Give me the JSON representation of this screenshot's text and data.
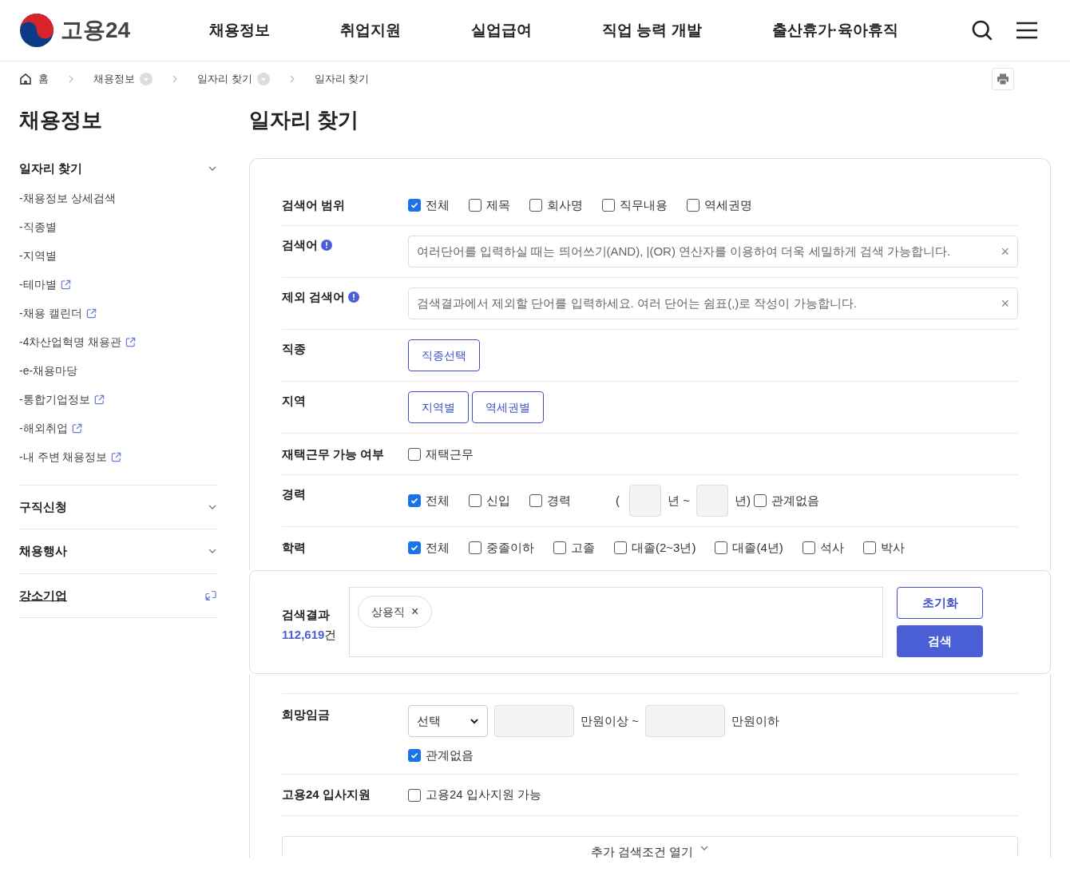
{
  "header": {
    "logo_text": "고용24",
    "nav": [
      "채용정보",
      "취업지원",
      "실업급여",
      "직업 능력 개발",
      "출산휴가·육아휴직"
    ]
  },
  "breadcrumb": [
    {
      "label": "홈",
      "kind": "home"
    },
    {
      "label": "채용정보",
      "kind": "dropdown"
    },
    {
      "label": "일자리 찾기",
      "kind": "dropdown"
    },
    {
      "label": "일자리 찾기",
      "kind": "plain"
    }
  ],
  "sidebar": {
    "title": "채용정보",
    "sections": [
      {
        "label": "일자리 찾기",
        "kind": "expand",
        "children": [
          {
            "label": "-채용정보 상세검색",
            "external": false
          },
          {
            "label": "-직종별",
            "external": false
          },
          {
            "label": "-지역별",
            "external": false
          },
          {
            "label": "-테마별",
            "external": true
          },
          {
            "label": "-채용 캘린더",
            "external": true
          },
          {
            "label": "-4차산업혁명 채용관",
            "external": true
          },
          {
            "label": "-e-채용마당",
            "external": false
          },
          {
            "label": "-통합기업정보",
            "external": true
          },
          {
            "label": "-해외취업",
            "external": true
          },
          {
            "label": "-내 주변 채용정보",
            "external": true
          }
        ]
      },
      {
        "label": "구직신청",
        "kind": "expand"
      },
      {
        "label": "채용행사",
        "kind": "expand"
      },
      {
        "label": "강소기업",
        "kind": "link"
      }
    ]
  },
  "page_title": "일자리 찾기",
  "form": {
    "rows": [
      {
        "label": "검색어 범위",
        "kind": "checks",
        "options": [
          {
            "label": "전체",
            "checked": true
          },
          {
            "label": "제목",
            "checked": false
          },
          {
            "label": "회사명",
            "checked": false
          },
          {
            "label": "직무내용",
            "checked": false
          },
          {
            "label": "역세권명",
            "checked": false
          }
        ]
      },
      {
        "label": "검색어",
        "kind": "text",
        "info": true,
        "placeholder": "여러단어를 입력하실 때는 띄어쓰기(AND), |(OR) 연산자를 이용하여 더욱 세밀하게 검색 가능합니다.",
        "clear": "×"
      },
      {
        "label": "제외 검색어",
        "kind": "text",
        "info": true,
        "placeholder": "검색결과에서 제외할 단어를 입력하세요. 여러 단어는 쉼표(,)로 작성이 가능합니다.",
        "clear": "×"
      },
      {
        "label": "직종",
        "kind": "buttons",
        "buttons": [
          "직종선택"
        ]
      },
      {
        "label": "지역",
        "kind": "buttons",
        "buttons": [
          "지역별",
          "역세권별"
        ]
      },
      {
        "label": "재택근무 가능 여부",
        "kind": "checks",
        "options": [
          {
            "label": "재택근무",
            "checked": false
          }
        ]
      },
      {
        "label": "경력",
        "kind": "career",
        "options": [
          {
            "label": "전체",
            "checked": true
          },
          {
            "label": "신입",
            "checked": false
          },
          {
            "label": "경력",
            "checked": false
          }
        ],
        "open": "(",
        "from_unit": "년 ~",
        "to_unit": "년)",
        "none": {
          "label": "관계없음",
          "checked": false
        }
      },
      {
        "label": "학력",
        "kind": "checks",
        "options": [
          {
            "label": "전체",
            "checked": true
          },
          {
            "label": "중졸이하",
            "checked": false
          },
          {
            "label": "고졸",
            "checked": false
          },
          {
            "label": "대졸(2~3년)",
            "checked": false
          },
          {
            "label": "대졸(4년)",
            "checked": false
          },
          {
            "label": "석사",
            "checked": false
          },
          {
            "label": "박사",
            "checked": false
          }
        ]
      }
    ],
    "result": {
      "label": "검색결과",
      "count": "112,619",
      "unit": "건",
      "tags": [
        {
          "label": "상용직",
          "remove": "×"
        }
      ],
      "reset": "초기화",
      "search": "검색"
    },
    "rows_after": [
      {
        "label": "희망임금",
        "kind": "wage",
        "select": "선택",
        "from_unit": "만원이상 ~",
        "to_unit": "만원이하",
        "none": {
          "label": "관계없음",
          "checked": true
        }
      },
      {
        "label": "고용24 입사지원",
        "kind": "checks",
        "options": [
          {
            "label": "고용24 입사지원 가능",
            "checked": false
          }
        ]
      }
    ],
    "more": "추가 검색조건 열기"
  }
}
